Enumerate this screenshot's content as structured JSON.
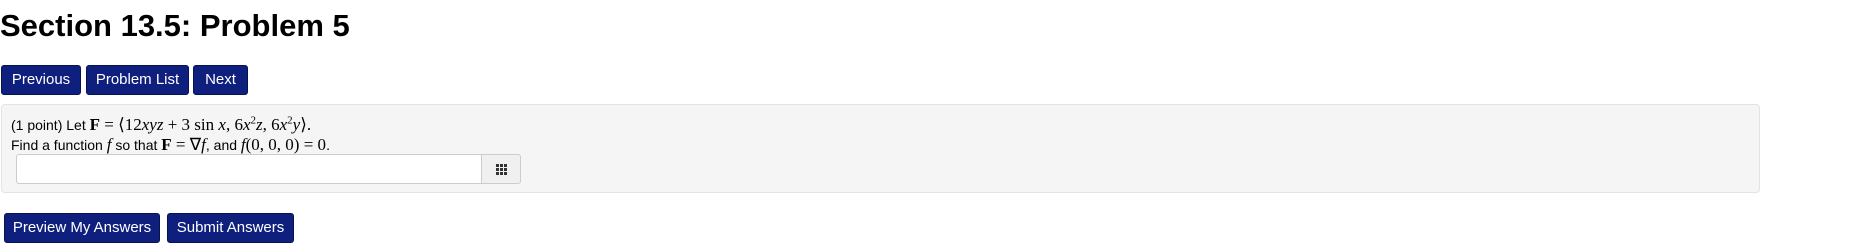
{
  "page_title": "Section 13.5: Problem 5",
  "nav": {
    "previous_label": "Previous",
    "problem_list_label": "Problem List",
    "next_label": "Next"
  },
  "problem": {
    "points": "(1 point)",
    "let_text": "Let",
    "field_vector": "⟨12xyz + 3 sin x, 6x²z, 6x²y⟩",
    "line2_prefix": "Find a function",
    "line2_mid1": "so that",
    "line2_mid2": ", and",
    "line2_end": ".",
    "answer_value": "",
    "answer_placeholder": ""
  },
  "actions": {
    "preview_label": "Preview My Answers",
    "submit_label": "Submit Answers"
  },
  "icons": {
    "equation_editor": "grid-icon"
  },
  "colors": {
    "button_bg": "#0f1f7d",
    "problem_bg": "#f5f5f5"
  }
}
